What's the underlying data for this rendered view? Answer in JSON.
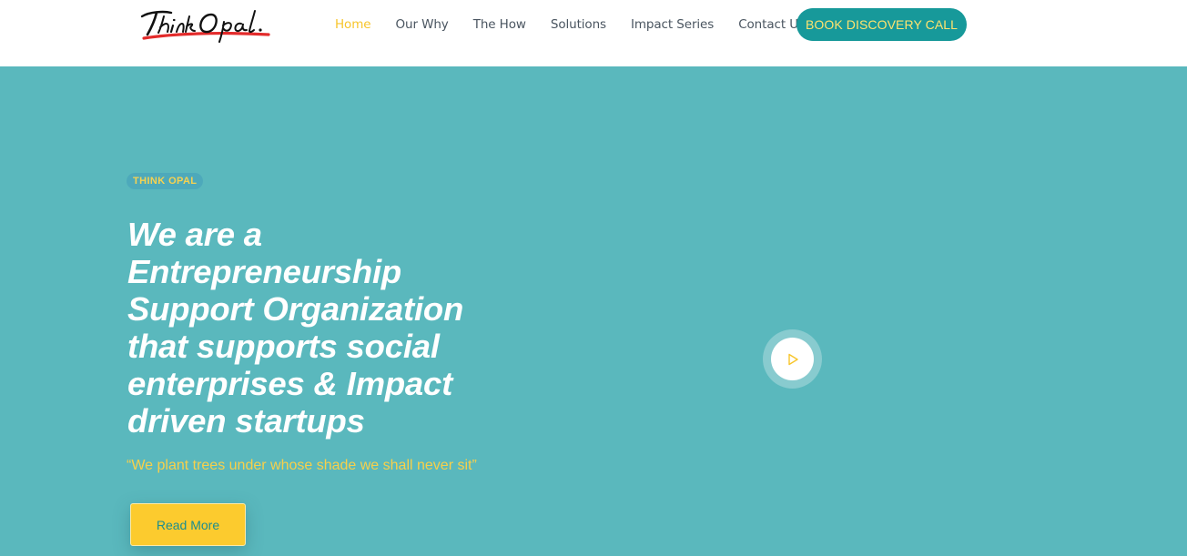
{
  "brand": {
    "logo_text": "ThinkOpal."
  },
  "nav": {
    "items": [
      {
        "label": "Home",
        "active": true
      },
      {
        "label": "Our Why",
        "active": false
      },
      {
        "label": "The How",
        "active": false
      },
      {
        "label": "Solutions",
        "active": false
      },
      {
        "label": "Impact Series",
        "active": false
      },
      {
        "label": "Contact Us",
        "active": false
      }
    ],
    "cta_label": "BOOK DISCOVERY CALL"
  },
  "hero": {
    "badge": "THINK OPAL",
    "headline_lines": [
      "We are a",
      "Entrepreneurship",
      "Support Organization",
      "that supports social",
      "enterprises & Impact",
      "driven startups"
    ],
    "quote": "“We plant trees under whose shade we shall never sit”",
    "read_more_label": "Read More",
    "play_icon": "play-icon"
  },
  "colors": {
    "hero_bg": "#5ab8bd",
    "accent_yellow": "#fccb2e",
    "cta_teal": "#17999a",
    "nav_text": "#4a5560"
  }
}
